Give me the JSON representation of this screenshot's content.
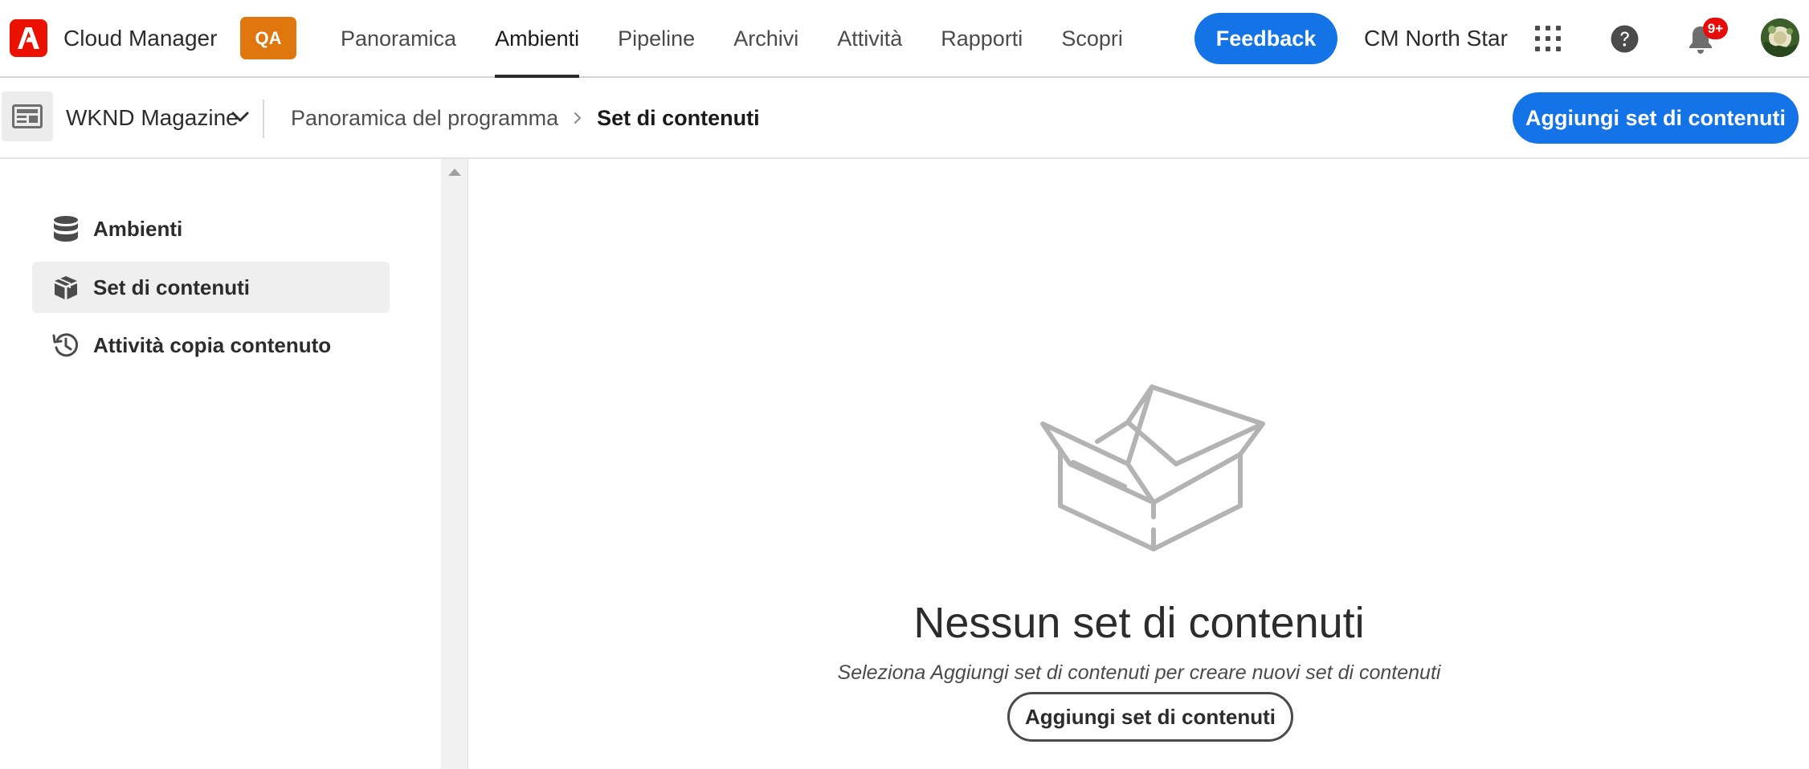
{
  "header": {
    "app_name": "Cloud Manager",
    "env_badge": "QA",
    "nav_tabs": [
      {
        "label": "Panoramica",
        "active": false
      },
      {
        "label": "Ambienti",
        "active": true
      },
      {
        "label": "Pipeline",
        "active": false
      },
      {
        "label": "Archivi",
        "active": false
      },
      {
        "label": "Attività",
        "active": false
      },
      {
        "label": "Rapporti",
        "active": false
      },
      {
        "label": "Scopri",
        "active": false
      }
    ],
    "feedback_label": "Feedback",
    "org_name": "CM North Star",
    "notification_count": "9+",
    "icons": [
      "adobe-logo-icon",
      "apps-grid-icon",
      "help-icon",
      "bell-icon",
      "avatar"
    ]
  },
  "subheader": {
    "program_name": "WKND Magazine",
    "breadcrumb": {
      "parent": "Panoramica del programma",
      "current": "Set di contenuti"
    },
    "add_button_label": "Aggiungi set di contenuti"
  },
  "sidebar": {
    "items": [
      {
        "label": "Ambienti",
        "icon": "database-icon",
        "selected": false
      },
      {
        "label": "Set di contenuti",
        "icon": "box-icon",
        "selected": true
      },
      {
        "label": "Attività copia contenuto",
        "icon": "history-icon",
        "selected": false
      }
    ]
  },
  "empty_state": {
    "title": "Nessun set di contenuti",
    "description": "Seleziona Aggiungi set di contenuti per creare nuovi set di contenuti",
    "button_label": "Aggiungi set di contenuti",
    "icon": "open-box-icon"
  },
  "colors": {
    "accent": "#1473e6",
    "brand": "#eb1000",
    "env_badge": "#e0760e",
    "notification": "#e60c0c"
  }
}
